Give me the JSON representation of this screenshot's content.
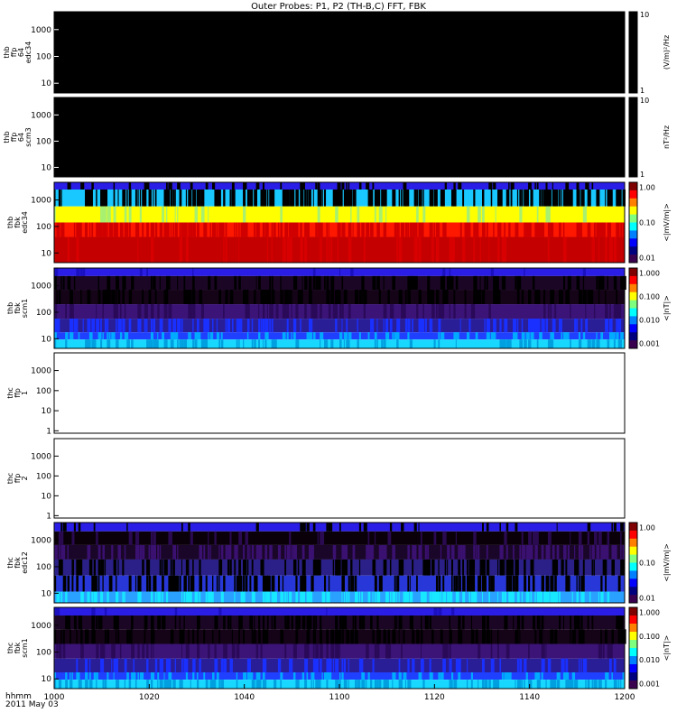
{
  "title": "Outer Probes: P1, P2 (TH-B,C) FFT, FBK",
  "time_axis": {
    "label_line1": "hhmm",
    "label_line2": "2011 May 03",
    "ticks": [
      "1000",
      "1020",
      "1040",
      "1100",
      "1120",
      "1140",
      "1200"
    ],
    "range": [
      1000,
      1200
    ]
  },
  "chart_data": [
    {
      "type": "heatmap",
      "panel_label": [
        "thb",
        "ffp",
        "64",
        "edc34"
      ],
      "y_ticks": [
        "10",
        "100",
        "1000"
      ],
      "yscale": "log",
      "colorbar": {
        "type": "log",
        "min_label": "1",
        "max_label": "10",
        "ticks": [],
        "unit": "(V/m)²/Hz"
      },
      "fill": "black",
      "bands": []
    },
    {
      "type": "heatmap",
      "panel_label": [
        "thb",
        "ffp",
        "64",
        "scm3"
      ],
      "y_ticks": [
        "10",
        "100",
        "1000"
      ],
      "yscale": "log",
      "colorbar": {
        "type": "log",
        "min_label": "1",
        "max_label": "10",
        "ticks": [],
        "unit": "nT²/Hz"
      },
      "fill": "black",
      "bands": []
    },
    {
      "type": "heatmap",
      "panel_label": [
        "thb",
        "fbk",
        "edc34"
      ],
      "y_ticks": [
        "10",
        "100",
        "1000"
      ],
      "yscale": "log",
      "colorbar": {
        "type": "log",
        "min_label": "",
        "max_label": "",
        "ticks": [
          "1.00",
          "0.10",
          "0.01"
        ],
        "unit": "<|mV/m|>"
      },
      "fill": "stack",
      "bands": [
        {
          "from": 0.0,
          "to": 0.09,
          "color": "#2a1ee6",
          "stripes": "#000000",
          "density": 0.25
        },
        {
          "from": 0.09,
          "to": 0.3,
          "color": "#18c8ff",
          "stripes": "#000000",
          "density": 0.55
        },
        {
          "from": 0.3,
          "to": 0.5,
          "color": "#ffff00",
          "stripes": "#a8f070",
          "density": 0.12
        },
        {
          "from": 0.5,
          "to": 0.68,
          "color": "#ff1800",
          "stripes": "#d00000",
          "density": 0.6
        },
        {
          "from": 0.68,
          "to": 1.0,
          "color": "#c40000",
          "stripes": "#d80000",
          "density": 0.15
        }
      ]
    },
    {
      "type": "heatmap",
      "panel_label": [
        "thb",
        "fbk",
        "scm1"
      ],
      "y_ticks": [
        "10",
        "100",
        "1000"
      ],
      "yscale": "log",
      "colorbar": {
        "type": "log",
        "min_label": "",
        "max_label": "",
        "ticks": [
          "1.000",
          "0.100",
          "0.010",
          "0.001"
        ],
        "unit": "<|nT|>"
      },
      "fill": "stack",
      "bands": [
        {
          "from": 0.0,
          "to": 0.1,
          "color": "#2a1ee6",
          "stripes": "#1a10c0",
          "density": 0.05
        },
        {
          "from": 0.1,
          "to": 0.27,
          "color": "#1c0626",
          "stripes": "#000000",
          "density": 0.3
        },
        {
          "from": 0.27,
          "to": 0.45,
          "color": "#150318",
          "stripes": "#000000",
          "density": 0.4
        },
        {
          "from": 0.45,
          "to": 0.63,
          "color": "#3c1478",
          "stripes": "#2a0a58",
          "density": 0.3
        },
        {
          "from": 0.63,
          "to": 0.8,
          "color": "#2a1e96",
          "stripes": "#1a30ff",
          "density": 0.35
        },
        {
          "from": 0.8,
          "to": 0.89,
          "color": "#2040ff",
          "stripes": "#00aaff",
          "density": 0.3
        },
        {
          "from": 0.89,
          "to": 1.0,
          "color": "#18d8ff",
          "stripes": "#00a0e0",
          "density": 0.25
        }
      ]
    },
    {
      "type": "heatmap",
      "panel_label": [
        "thc",
        "ffp",
        "1"
      ],
      "y_ticks": [
        "1",
        "10",
        "100",
        "1000"
      ],
      "yscale": "log",
      "colorbar": null,
      "fill": "white",
      "bands": []
    },
    {
      "type": "heatmap",
      "panel_label": [
        "thc",
        "ffp",
        "2"
      ],
      "y_ticks": [
        "1",
        "10",
        "100",
        "1000"
      ],
      "yscale": "log",
      "colorbar": null,
      "fill": "white",
      "bands": []
    },
    {
      "type": "heatmap",
      "panel_label": [
        "thc",
        "fbk",
        "edc12"
      ],
      "y_ticks": [
        "10",
        "100",
        "1000"
      ],
      "yscale": "log",
      "colorbar": {
        "type": "log",
        "min_label": "",
        "max_label": "",
        "ticks": [
          "1.00",
          "0.10",
          "0.01"
        ],
        "unit": "<|mV/m|>"
      },
      "fill": "stack",
      "bands": [
        {
          "from": 0.0,
          "to": 0.11,
          "color": "#2a1ee6",
          "stripes": "#000000",
          "density": 0.1
        },
        {
          "from": 0.11,
          "to": 0.28,
          "color": "#0a000a",
          "stripes": "#2a0a50",
          "density": 0.15
        },
        {
          "from": 0.28,
          "to": 0.46,
          "color": "#1a0628",
          "stripes": "#3a1070",
          "density": 0.45
        },
        {
          "from": 0.46,
          "to": 0.66,
          "color": "#2a2088",
          "stripes": "#000000",
          "density": 0.35
        },
        {
          "from": 0.66,
          "to": 0.86,
          "color": "#2838d8",
          "stripes": "#000000",
          "density": 0.4
        },
        {
          "from": 0.86,
          "to": 1.0,
          "color": "#2aa0ff",
          "stripes": "#18e8ff",
          "density": 0.45
        }
      ]
    },
    {
      "type": "heatmap",
      "panel_label": [
        "thc",
        "fbk",
        "scm1"
      ],
      "y_ticks": [
        "10",
        "100",
        "1000"
      ],
      "yscale": "log",
      "colorbar": {
        "type": "log",
        "min_label": "",
        "max_label": "",
        "ticks": [
          "1.000",
          "0.100",
          "0.010",
          "0.001"
        ],
        "unit": "<|nT|>"
      },
      "fill": "stack",
      "bands": [
        {
          "from": 0.0,
          "to": 0.1,
          "color": "#2a1ee6",
          "stripes": "#1a10c0",
          "density": 0.05
        },
        {
          "from": 0.1,
          "to": 0.27,
          "color": "#1c0626",
          "stripes": "#000000",
          "density": 0.3
        },
        {
          "from": 0.27,
          "to": 0.45,
          "color": "#150318",
          "stripes": "#000000",
          "density": 0.35
        },
        {
          "from": 0.45,
          "to": 0.63,
          "color": "#3c1478",
          "stripes": "#2a0a58",
          "density": 0.25
        },
        {
          "from": 0.63,
          "to": 0.8,
          "color": "#2a1e96",
          "stripes": "#1a30ff",
          "density": 0.3
        },
        {
          "from": 0.8,
          "to": 0.89,
          "color": "#2040ff",
          "stripes": "#00aaff",
          "density": 0.3
        },
        {
          "from": 0.89,
          "to": 1.0,
          "color": "#18d8ff",
          "stripes": "#00a0e0",
          "density": 0.4
        }
      ]
    }
  ]
}
